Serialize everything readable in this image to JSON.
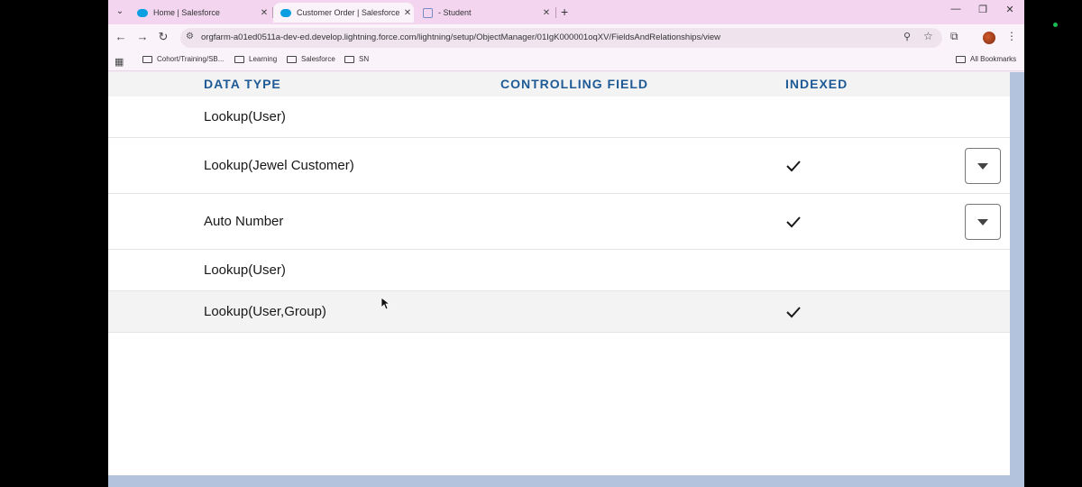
{
  "browser": {
    "tabs": [
      {
        "title": "Home | Salesforce",
        "icon": "salesforce-cloud-icon",
        "active": false
      },
      {
        "title": "Customer Order | Salesforce",
        "icon": "salesforce-cloud-icon",
        "active": true
      },
      {
        "title": "- Student",
        "icon": "document-icon",
        "active": false
      }
    ],
    "tab_close": "✕",
    "new_tab": "+",
    "window_controls": {
      "minimize": "—",
      "restore": "❐",
      "close": "✕"
    },
    "url": "orgfarm-a01ed0511a-dev-ed.develop.lightning.force.com/lightning/setup/ObjectManager/01IgK000001oqXV/FieldsAndRelationships/view",
    "nav": {
      "back": "←",
      "forward": "→",
      "reload": "↻"
    },
    "bookmarks": [
      "Cohort/Training/SB...",
      "Learning",
      "Salesforce",
      "SN"
    ],
    "all_bookmarks": "All Bookmarks"
  },
  "table": {
    "headers": {
      "data_type": "DATA TYPE",
      "controlling_field": "CONTROLLING FIELD",
      "indexed": "INDEXED"
    },
    "rows": [
      {
        "data_type": "Lookup(User)",
        "indexed": false,
        "has_menu": false
      },
      {
        "data_type": "Lookup(Jewel Customer)",
        "indexed": true,
        "has_menu": true
      },
      {
        "data_type": "Auto Number",
        "indexed": true,
        "has_menu": true
      },
      {
        "data_type": "Lookup(User)",
        "indexed": false,
        "has_menu": false
      },
      {
        "data_type": "Lookup(User,Group)",
        "indexed": true,
        "has_menu": false
      }
    ]
  },
  "colors": {
    "header_text": "#1d5a96",
    "tabstrip": "#f3d5ef",
    "page_bg": "#ffffff",
    "frame_blue": "#b4c3dd"
  }
}
